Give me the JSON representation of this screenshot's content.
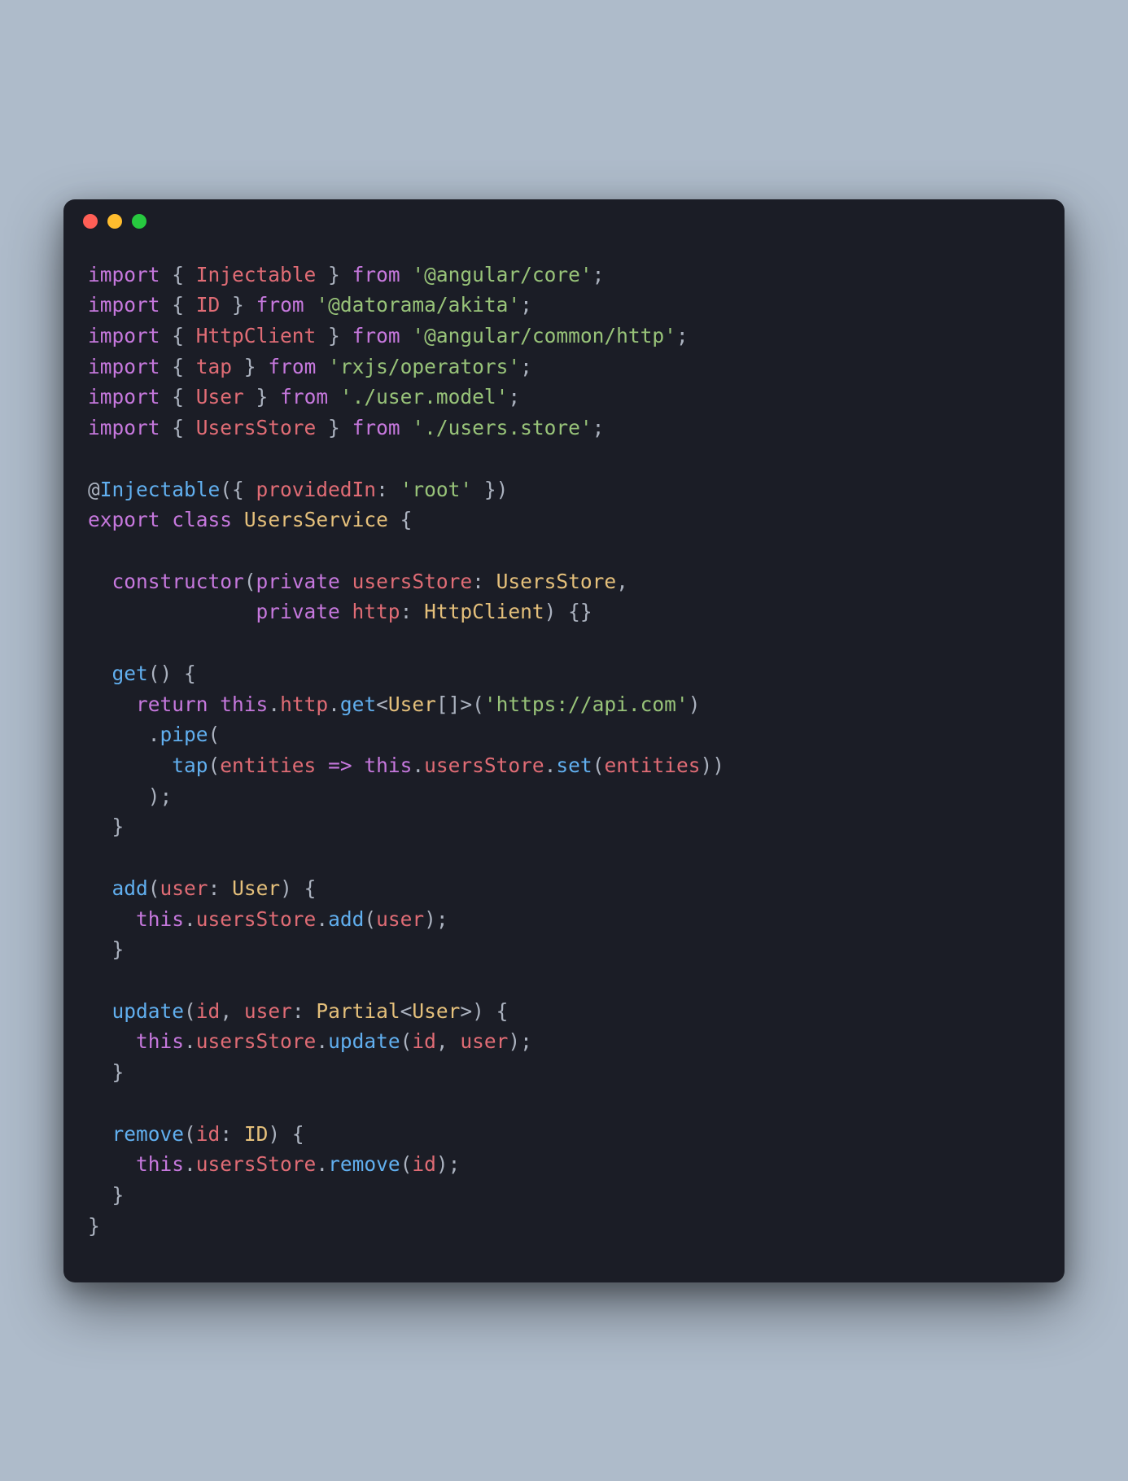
{
  "window": {
    "traffic_lights": [
      "red",
      "yellow",
      "green"
    ]
  },
  "code": {
    "tokens": [
      [
        [
          "kw",
          "import"
        ],
        [
          "plain",
          " { "
        ],
        [
          "id",
          "Injectable"
        ],
        [
          "plain",
          " } "
        ],
        [
          "kw",
          "from"
        ],
        [
          "plain",
          " "
        ],
        [
          "str",
          "'@angular/core'"
        ],
        [
          "plain",
          ";"
        ]
      ],
      [
        [
          "kw",
          "import"
        ],
        [
          "plain",
          " { "
        ],
        [
          "id",
          "ID"
        ],
        [
          "plain",
          " } "
        ],
        [
          "kw",
          "from"
        ],
        [
          "plain",
          " "
        ],
        [
          "str",
          "'@datorama/akita'"
        ],
        [
          "plain",
          ";"
        ]
      ],
      [
        [
          "kw",
          "import"
        ],
        [
          "plain",
          " { "
        ],
        [
          "id",
          "HttpClient"
        ],
        [
          "plain",
          " } "
        ],
        [
          "kw",
          "from"
        ],
        [
          "plain",
          " "
        ],
        [
          "str",
          "'@angular/common/http'"
        ],
        [
          "plain",
          ";"
        ]
      ],
      [
        [
          "kw",
          "import"
        ],
        [
          "plain",
          " { "
        ],
        [
          "id",
          "tap"
        ],
        [
          "plain",
          " } "
        ],
        [
          "kw",
          "from"
        ],
        [
          "plain",
          " "
        ],
        [
          "str",
          "'rxjs/operators'"
        ],
        [
          "plain",
          ";"
        ]
      ],
      [
        [
          "kw",
          "import"
        ],
        [
          "plain",
          " { "
        ],
        [
          "id",
          "User"
        ],
        [
          "plain",
          " } "
        ],
        [
          "kw",
          "from"
        ],
        [
          "plain",
          " "
        ],
        [
          "str",
          "'./user.model'"
        ],
        [
          "plain",
          ";"
        ]
      ],
      [
        [
          "kw",
          "import"
        ],
        [
          "plain",
          " { "
        ],
        [
          "id",
          "UsersStore"
        ],
        [
          "plain",
          " } "
        ],
        [
          "kw",
          "from"
        ],
        [
          "plain",
          " "
        ],
        [
          "str",
          "'./users.store'"
        ],
        [
          "plain",
          ";"
        ]
      ],
      [],
      [
        [
          "plain",
          "@"
        ],
        [
          "fn",
          "Injectable"
        ],
        [
          "plain",
          "({ "
        ],
        [
          "id",
          "providedIn"
        ],
        [
          "plain",
          ": "
        ],
        [
          "str",
          "'root'"
        ],
        [
          "plain",
          " })"
        ]
      ],
      [
        [
          "kw",
          "export"
        ],
        [
          "plain",
          " "
        ],
        [
          "kw",
          "class"
        ],
        [
          "plain",
          " "
        ],
        [
          "cls",
          "UsersService"
        ],
        [
          "plain",
          " {"
        ]
      ],
      [],
      [
        [
          "plain",
          "  "
        ],
        [
          "kw",
          "constructor"
        ],
        [
          "plain",
          "("
        ],
        [
          "kw",
          "private"
        ],
        [
          "plain",
          " "
        ],
        [
          "id",
          "usersStore"
        ],
        [
          "plain",
          ": "
        ],
        [
          "cls",
          "UsersStore"
        ],
        [
          "plain",
          ","
        ]
      ],
      [
        [
          "plain",
          "              "
        ],
        [
          "kw",
          "private"
        ],
        [
          "plain",
          " "
        ],
        [
          "id",
          "http"
        ],
        [
          "plain",
          ": "
        ],
        [
          "cls",
          "HttpClient"
        ],
        [
          "plain",
          ") {}"
        ]
      ],
      [],
      [
        [
          "plain",
          "  "
        ],
        [
          "fn",
          "get"
        ],
        [
          "plain",
          "() {"
        ]
      ],
      [
        [
          "plain",
          "    "
        ],
        [
          "kw",
          "return"
        ],
        [
          "plain",
          " "
        ],
        [
          "kw",
          "this"
        ],
        [
          "plain",
          "."
        ],
        [
          "id",
          "http"
        ],
        [
          "plain",
          "."
        ],
        [
          "fn",
          "get"
        ],
        [
          "plain",
          "<"
        ],
        [
          "cls",
          "User"
        ],
        [
          "plain",
          "[]>("
        ],
        [
          "str",
          "'https://api.com'"
        ],
        [
          "plain",
          ")"
        ]
      ],
      [
        [
          "plain",
          "     ."
        ],
        [
          "fn",
          "pipe"
        ],
        [
          "plain",
          "("
        ]
      ],
      [
        [
          "plain",
          "       "
        ],
        [
          "fn",
          "tap"
        ],
        [
          "plain",
          "("
        ],
        [
          "id",
          "entities"
        ],
        [
          "plain",
          " "
        ],
        [
          "kw",
          "=>"
        ],
        [
          "plain",
          " "
        ],
        [
          "kw",
          "this"
        ],
        [
          "plain",
          "."
        ],
        [
          "id",
          "usersStore"
        ],
        [
          "plain",
          "."
        ],
        [
          "fn",
          "set"
        ],
        [
          "plain",
          "("
        ],
        [
          "id",
          "entities"
        ],
        [
          "plain",
          "))"
        ]
      ],
      [
        [
          "plain",
          "     );"
        ]
      ],
      [
        [
          "plain",
          "  }"
        ]
      ],
      [],
      [
        [
          "plain",
          "  "
        ],
        [
          "fn",
          "add"
        ],
        [
          "plain",
          "("
        ],
        [
          "id",
          "user"
        ],
        [
          "plain",
          ": "
        ],
        [
          "cls",
          "User"
        ],
        [
          "plain",
          ") {"
        ]
      ],
      [
        [
          "plain",
          "    "
        ],
        [
          "kw",
          "this"
        ],
        [
          "plain",
          "."
        ],
        [
          "id",
          "usersStore"
        ],
        [
          "plain",
          "."
        ],
        [
          "fn",
          "add"
        ],
        [
          "plain",
          "("
        ],
        [
          "id",
          "user"
        ],
        [
          "plain",
          ");"
        ]
      ],
      [
        [
          "plain",
          "  }"
        ]
      ],
      [],
      [
        [
          "plain",
          "  "
        ],
        [
          "fn",
          "update"
        ],
        [
          "plain",
          "("
        ],
        [
          "id",
          "id"
        ],
        [
          "plain",
          ", "
        ],
        [
          "id",
          "user"
        ],
        [
          "plain",
          ": "
        ],
        [
          "cls",
          "Partial"
        ],
        [
          "plain",
          "<"
        ],
        [
          "cls",
          "User"
        ],
        [
          "plain",
          ">) {"
        ]
      ],
      [
        [
          "plain",
          "    "
        ],
        [
          "kw",
          "this"
        ],
        [
          "plain",
          "."
        ],
        [
          "id",
          "usersStore"
        ],
        [
          "plain",
          "."
        ],
        [
          "fn",
          "update"
        ],
        [
          "plain",
          "("
        ],
        [
          "id",
          "id"
        ],
        [
          "plain",
          ", "
        ],
        [
          "id",
          "user"
        ],
        [
          "plain",
          ");"
        ]
      ],
      [
        [
          "plain",
          "  }"
        ]
      ],
      [],
      [
        [
          "plain",
          "  "
        ],
        [
          "fn",
          "remove"
        ],
        [
          "plain",
          "("
        ],
        [
          "id",
          "id"
        ],
        [
          "plain",
          ": "
        ],
        [
          "cls",
          "ID"
        ],
        [
          "plain",
          ") {"
        ]
      ],
      [
        [
          "plain",
          "    "
        ],
        [
          "kw",
          "this"
        ],
        [
          "plain",
          "."
        ],
        [
          "id",
          "usersStore"
        ],
        [
          "plain",
          "."
        ],
        [
          "fn",
          "remove"
        ],
        [
          "plain",
          "("
        ],
        [
          "id",
          "id"
        ],
        [
          "plain",
          ");"
        ]
      ],
      [
        [
          "plain",
          "  }"
        ]
      ],
      [
        [
          "plain",
          "}"
        ]
      ]
    ]
  }
}
